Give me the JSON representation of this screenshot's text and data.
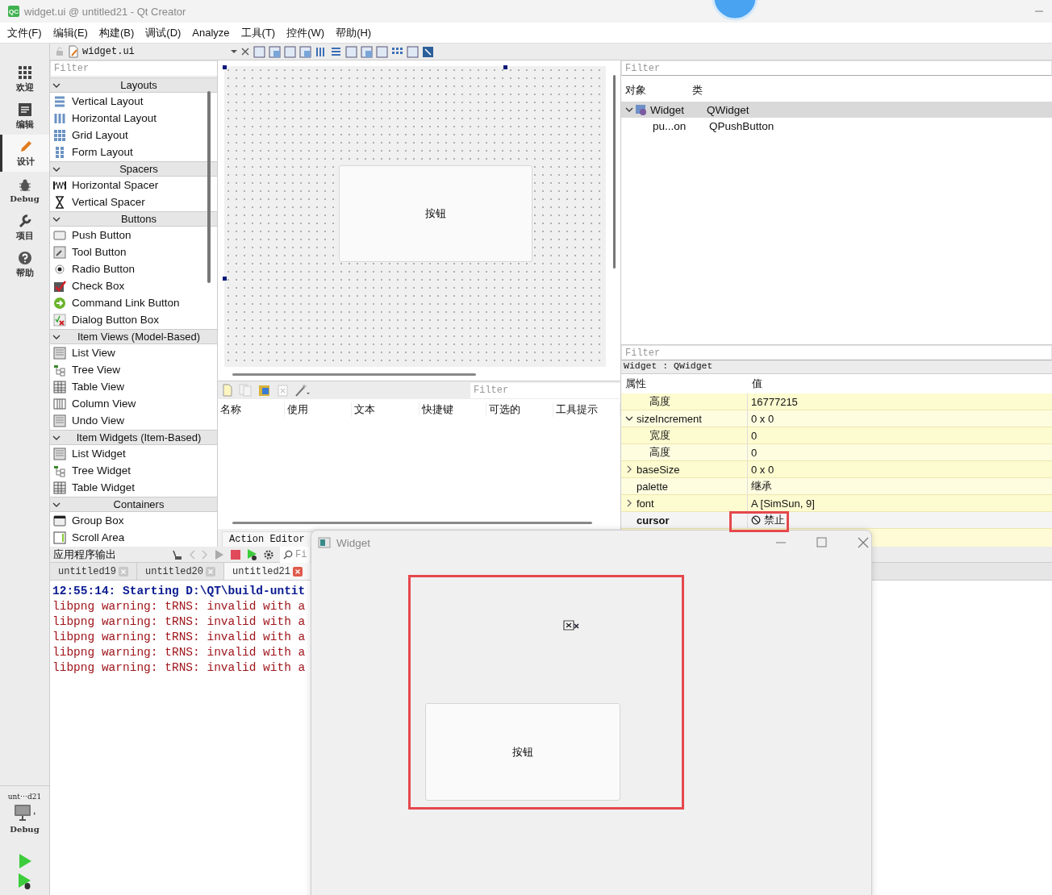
{
  "window": {
    "logo": "QC",
    "title": "widget.ui @ untitled21 - Qt Creator"
  },
  "menu": [
    "文件(F)",
    "编辑(E)",
    "构建(B)",
    "调试(D)",
    "Analyze",
    "工具(T)",
    "控件(W)",
    "帮助(H)"
  ],
  "modes": [
    {
      "label": "欢迎",
      "selected": false
    },
    {
      "label": "编辑",
      "selected": false
    },
    {
      "label": "设计",
      "selected": true
    },
    {
      "label": "Debug",
      "selected": false
    },
    {
      "label": "项目",
      "selected": false
    },
    {
      "label": "帮助",
      "selected": false
    }
  ],
  "run_target": {
    "project": "unt⋯d21",
    "config": "Debug"
  },
  "editor_toolbar": {
    "file": "widget.ui"
  },
  "widget_box": {
    "filter_placeholder": "Filter",
    "sections": [
      {
        "title": "Layouts",
        "expanded": true,
        "items": [
          "Vertical Layout",
          "Horizontal Layout",
          "Grid Layout",
          "Form Layout"
        ]
      },
      {
        "title": "Spacers",
        "expanded": true,
        "items": [
          "Horizontal Spacer",
          "Vertical Spacer"
        ]
      },
      {
        "title": "Buttons",
        "expanded": true,
        "items": [
          "Push Button",
          "Tool Button",
          "Radio Button",
          "Check Box",
          "Command Link Button",
          "Dialog Button Box"
        ]
      },
      {
        "title": "Item Views (Model-Based)",
        "expanded": true,
        "items": [
          "List View",
          "Tree View",
          "Table View",
          "Column View",
          "Undo View"
        ]
      },
      {
        "title": "Item Widgets (Item-Based)",
        "expanded": true,
        "items": [
          "List Widget",
          "Tree Widget",
          "Table Widget"
        ]
      },
      {
        "title": "Containers",
        "expanded": true,
        "items": [
          "Group Box",
          "Scroll Area"
        ]
      }
    ]
  },
  "form": {
    "button": "按钮"
  },
  "action_editor": {
    "filter_placeholder": "Filter",
    "columns": [
      "名称",
      "使用",
      "文本",
      "快捷键",
      "可选的",
      "工具提示"
    ],
    "tab": "Action Editor"
  },
  "object_inspector": {
    "filter_placeholder": "Filter",
    "columns": [
      "对象",
      "类"
    ],
    "rows": [
      {
        "object": "Widget",
        "class": "QWidget",
        "selected": true,
        "expanded": true,
        "children": [
          {
            "object": "pu...on",
            "class": "QPushButton",
            "selected": false
          }
        ]
      }
    ]
  },
  "property_editor": {
    "filter_placeholder": "Filter",
    "object": "Widget : QWidget",
    "columns": [
      "属性",
      "值"
    ],
    "rows": [
      {
        "kind": "sub",
        "name": "高度",
        "value": "16777215"
      },
      {
        "kind": "prop",
        "name": "sizeIncrement",
        "value": "0 x 0",
        "expanded": true,
        "children": [
          {
            "kind": "sub",
            "name": "宽度",
            "value": "0"
          },
          {
            "kind": "sub",
            "name": "高度",
            "value": "0"
          }
        ]
      },
      {
        "kind": "prop",
        "name": "baseSize",
        "value": "0 x 0",
        "expanded": false
      },
      {
        "kind": "prop",
        "name": "palette",
        "value": "继承"
      },
      {
        "kind": "prop",
        "name": "font",
        "value": "A  [SimSun, 9]",
        "expanded": false
      },
      {
        "kind": "prop",
        "name": "cursor",
        "value": "禁止",
        "changed": true,
        "selected": true
      }
    ]
  },
  "output": {
    "title": "应用程序输出",
    "filter_placeholder": "Fi",
    "tabs": [
      {
        "label": "untitled19",
        "selected": false
      },
      {
        "label": "untitled20",
        "selected": false
      },
      {
        "label": "untitled21",
        "selected": true
      }
    ],
    "lines": [
      {
        "kind": "info",
        "text": "12:55:14: Starting D:\\QT\\build-untit"
      },
      {
        "kind": "error",
        "text": "libpng warning: tRNS: invalid with a"
      },
      {
        "kind": "error",
        "text": "libpng warning: tRNS: invalid with a"
      },
      {
        "kind": "error",
        "text": "libpng warning: tRNS: invalid with a"
      },
      {
        "kind": "error",
        "text": "libpng warning: tRNS: invalid with a"
      },
      {
        "kind": "error",
        "text": "libpng warning: tRNS: invalid with a"
      }
    ]
  },
  "app_window": {
    "title": "Widget",
    "button": "按钮"
  }
}
